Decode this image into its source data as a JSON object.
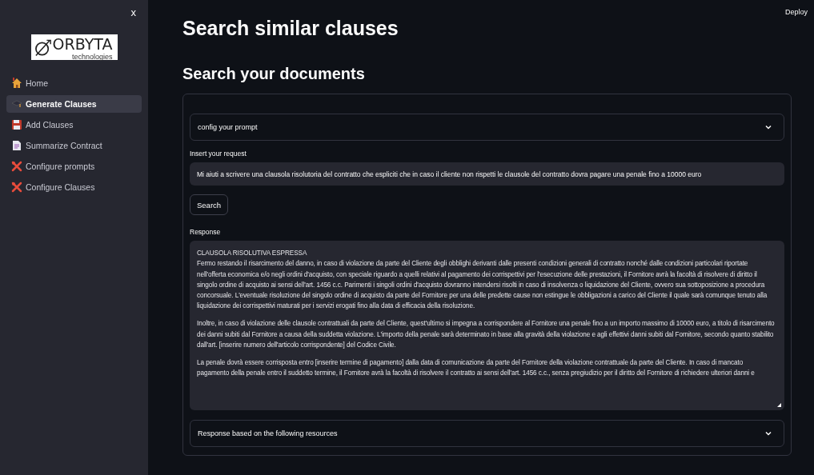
{
  "sidebar": {
    "close": "x",
    "logo": {
      "name": "ORBYTA",
      "tagline": "technologies"
    },
    "items": [
      {
        "label": "Home",
        "selected": false
      },
      {
        "label": "Generate Clauses",
        "selected": true
      },
      {
        "label": "Add Clauses",
        "selected": false
      },
      {
        "label": "Summarize Contract",
        "selected": false
      },
      {
        "label": "Configure prompts",
        "selected": false
      },
      {
        "label": "Configure Clauses",
        "selected": false
      }
    ]
  },
  "header": {
    "deploy": "Deploy"
  },
  "main": {
    "title": "Search similar clauses",
    "subtitle": "Search your documents",
    "config_expander": {
      "label": "config your prompt",
      "expanded": false
    },
    "request": {
      "label": "Insert your request",
      "value": "Mi aiuti a scrivere una clausola risolutoria del contratto che espliciti che in caso il cliente non rispetti le clausole del contratto dovra pagare una penale fino a 10000 euro"
    },
    "search_button": "Search",
    "response": {
      "label": "Response",
      "paragraphs": [
        "CLAUSOLA RISOLUTIVA ESPRESSA\nFermo restando il risarcimento del danno, in caso di violazione da parte del Cliente degli obblighi derivanti dalle presenti condizioni generali di contratto nonché dalle condizioni particolari riportate nell'offerta economica e/o negli ordini d'acquisto, con speciale riguardo a quelli relativi al pagamento dei corrispettivi per l'esecuzione delle prestazioni, il Fornitore avrà la facoltà di risolvere di diritto il singolo ordine di acquisto ai sensi dell'art. 1456 c.c. Parimenti i singoli ordini d'acquisto dovranno intendersi risolti in caso di insolvenza o liquidazione del Cliente, ovvero sua sottoposizione a procedura concorsuale. L'eventuale risoluzione del singolo ordine di acquisto da parte del Fornitore per una delle predette cause non estingue le obbligazioni a carico del Cliente il quale sarà comunque tenuto alla liquidazione dei corrispettivi maturati per i servizi erogati fino alla data di efficacia della risoluzione.",
        "Inoltre, in caso di violazione delle clausole contrattuali da parte del Cliente, quest'ultimo si impegna a corrispondere al Fornitore una penale fino a un importo massimo di 10000 euro, a titolo di risarcimento dei danni subiti dal Fornitore a causa della suddetta violazione. L'importo della penale sarà determinato in base alla gravità della violazione e agli effettivi danni subiti dal Fornitore, secondo quanto stabilito dall'art. [inserire numero dell'articolo corrispondente] del Codice Civile.",
        "La penale dovrà essere corrisposta entro [inserire termine di pagamento] dalla data di comunicazione da parte del Fornitore della violazione contrattuale da parte del Cliente. In caso di mancato pagamento della penale entro il suddetto termine, il Fornitore avrà la facoltà di risolvere il contratto ai sensi dell'art. 1456 c.c., senza pregiudizio per il diritto del Fornitore di richiedere ulteriori danni e"
      ]
    },
    "resources_expander": {
      "label": "Response based on the following resources",
      "expanded": false
    }
  }
}
